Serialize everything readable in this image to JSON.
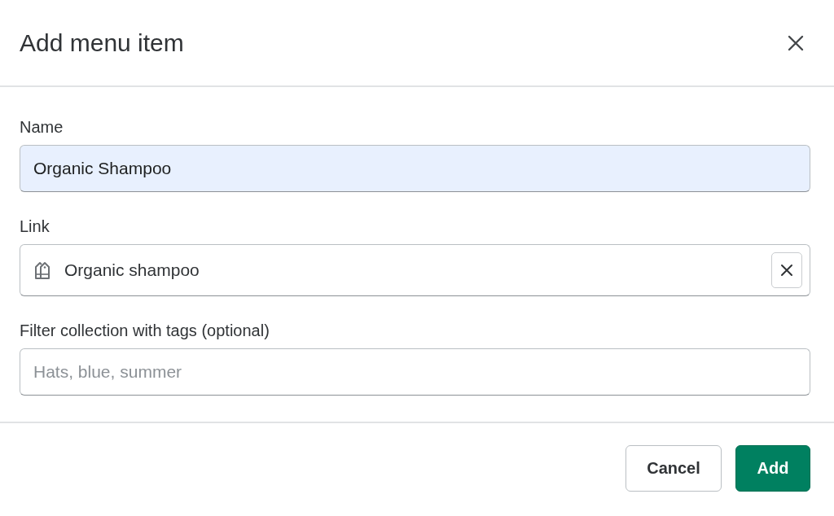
{
  "dialog": {
    "title": "Add menu item",
    "fields": [
      {
        "kind": "text",
        "label": "Name",
        "value": "Organic Shampoo",
        "autofilled": true
      },
      {
        "kind": "link",
        "label": "Link",
        "value": "Organic shampoo"
      },
      {
        "kind": "text",
        "label": "Filter collection with tags (optional)",
        "placeholder": "Hats, blue, summer",
        "autofilled": false
      }
    ],
    "buttons": [
      {
        "kind": "secondary",
        "label": "Cancel"
      },
      {
        "kind": "primary",
        "label": "Add"
      }
    ]
  }
}
